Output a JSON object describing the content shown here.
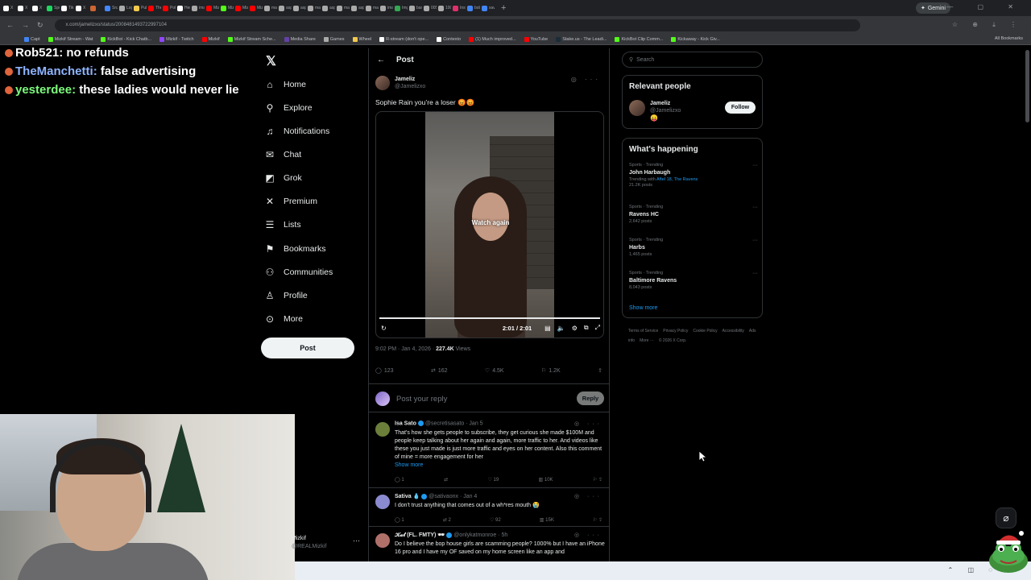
{
  "browser": {
    "tabs": [
      {
        "label": "X",
        "color": "#ffffff"
      },
      {
        "label": "X",
        "color": "#ffffff"
      },
      {
        "label": "X",
        "color": "#ffffff"
      },
      {
        "label": "Spo",
        "color": "#1ed760"
      },
      {
        "label": "Tik",
        "color": "#ffffff"
      },
      {
        "label": "X",
        "color": "#ffffff"
      },
      {
        "label": "",
        "color": "#cc6633"
      },
      {
        "label": "Snz",
        "color": "#4488ff"
      },
      {
        "label": "Log",
        "color": "#aaaaaa"
      },
      {
        "label": "Pull",
        "color": "#f2c94c"
      },
      {
        "label": "The",
        "color": "#ff0000"
      },
      {
        "label": "Pok",
        "color": "#ff0000"
      },
      {
        "label": "Hen",
        "color": "#ffffff"
      },
      {
        "label": "ima",
        "color": "#aaaaaa"
      },
      {
        "label": "Miz",
        "color": "#ff0000"
      },
      {
        "label": "Miz",
        "color": "#53fc18"
      },
      {
        "label": "Miz",
        "color": "#ff0000"
      },
      {
        "label": "Miz",
        "color": "#ff0000"
      },
      {
        "label": "ma",
        "color": "#aaaaaa"
      },
      {
        "label": "asp",
        "color": "#aaaaaa"
      },
      {
        "label": "asp",
        "color": "#aaaaaa"
      },
      {
        "label": "ma",
        "color": "#aaaaaa"
      },
      {
        "label": "asp",
        "color": "#aaaaaa"
      },
      {
        "label": "ma",
        "color": "#aaaaaa"
      },
      {
        "label": "asp",
        "color": "#aaaaaa"
      },
      {
        "label": "ma",
        "color": "#aaaaaa"
      },
      {
        "label": "ima",
        "color": "#aaaaaa"
      },
      {
        "label": "Img",
        "color": "#34a853"
      },
      {
        "label": "ban",
        "color": "#aaaaaa"
      },
      {
        "label": "005",
        "color": "#aaaaaa"
      },
      {
        "label": "100",
        "color": "#aaaaaa"
      },
      {
        "label": "Inst",
        "color": "#e1306c"
      },
      {
        "label": "bob",
        "color": "#4285f4"
      },
      {
        "label": "xav",
        "color": "#4285f4"
      }
    ],
    "new_tab": "+",
    "gemini_label": "Gemini",
    "window_controls": "— ▢ ✕",
    "url": "x.com/jamelizxo/status/2008481493722997104",
    "bookmarks": [
      {
        "label": "Capt",
        "color": "#4285f4"
      },
      {
        "label": "Mizkif Stream - Wat",
        "color": "#53fc18"
      },
      {
        "label": "KickBot - Kick Chatb...",
        "color": "#53fc18"
      },
      {
        "label": "Mizkif - Twitch",
        "color": "#9146ff"
      },
      {
        "label": "Mizkif",
        "color": "#ff0000"
      },
      {
        "label": "Mizkif Stream Sche...",
        "color": "#53fc18"
      },
      {
        "label": "Media Share",
        "color": "#6441a5"
      },
      {
        "label": "Games",
        "color": "#aaaaaa"
      },
      {
        "label": "Wheel",
        "color": "#f2c94c"
      },
      {
        "label": "R-stream (don't ope...",
        "color": "#ffffff"
      },
      {
        "label": "Contexto",
        "color": "#ffffff"
      },
      {
        "label": "(1) Much improved...",
        "color": "#ff0000"
      },
      {
        "label": "YouTube",
        "color": "#ff0000"
      },
      {
        "label": "Stake.us - The Leadi...",
        "color": "#1a2c38"
      },
      {
        "label": "KickBot Clip Comm...",
        "color": "#53fc18"
      },
      {
        "label": "Kickaway - Kick Giv...",
        "color": "#53fc18"
      }
    ],
    "all_bookmarks": "All Bookmarks"
  },
  "stream_chat": [
    {
      "user": "Rob521",
      "message": "no refunds",
      "color": "#ffffff"
    },
    {
      "user": "TheManchetti",
      "message": "false advertising",
      "color": "#8fb4ff"
    },
    {
      "user": "yesterdee",
      "message": "these ladies would never lie",
      "color": "#7cfc7c"
    }
  ],
  "x_sidebar": {
    "logo": "𝕏",
    "items": [
      {
        "label": "Home",
        "icon": "home-icon",
        "glyph": "⌂"
      },
      {
        "label": "Explore",
        "icon": "search-icon",
        "glyph": "⚲"
      },
      {
        "label": "Notifications",
        "icon": "bell-icon",
        "glyph": "♫"
      },
      {
        "label": "Chat",
        "icon": "mail-icon",
        "glyph": "✉"
      },
      {
        "label": "Grok",
        "icon": "grok-icon",
        "glyph": "◩"
      },
      {
        "label": "Premium",
        "icon": "x-icon",
        "glyph": "✕"
      },
      {
        "label": "Lists",
        "icon": "list-icon",
        "glyph": "☰"
      },
      {
        "label": "Bookmarks",
        "icon": "bookmark-icon",
        "glyph": "⚑"
      },
      {
        "label": "Communities",
        "icon": "people-icon",
        "glyph": "⚇"
      },
      {
        "label": "Profile",
        "icon": "person-icon",
        "glyph": "♙"
      },
      {
        "label": "More",
        "icon": "more-circle-icon",
        "glyph": "⊙"
      }
    ],
    "post_button": "Post",
    "account": {
      "name": "Mizkif",
      "handle": "@REALMizkif"
    },
    "dots": "···"
  },
  "post": {
    "back": "←",
    "header": "Post",
    "author": {
      "name": "Jameliz",
      "handle": "@Jamelizxo"
    },
    "tools": "◎ ···",
    "text": "Sophie Rain you’re a loser 😡😡",
    "video": {
      "watch_again": "Watch again",
      "time": "2:01 / 2:01",
      "progress": 1.0
    },
    "time": "9:02 PM · Jan 4, 2026 · ",
    "views_count": "227.4K",
    "views_label": " Views",
    "actions": {
      "replies": "123",
      "reposts": "162",
      "likes": "4.5K",
      "bookmarks": "1.2K"
    },
    "reply_placeholder": "Post your reply",
    "reply_button": "Reply"
  },
  "replies": [
    {
      "name": "Isa Sato",
      "handle": "@secretisasato · Jan 5",
      "text": "That's how she gets people to subscribe, they get curious she made $100M and people keep talking about her again and again, more traffic to her. And videos like these you just made is just more traffic and eyes on her content. Also this comment of mine = more engagement for her",
      "show_more": "Show more",
      "replies": "1",
      "reposts": "",
      "likes": "19",
      "views": "10K",
      "avatar": "#6b7f3a"
    },
    {
      "name": "Sativa 💧",
      "handle": "@sativaonx · Jan 4",
      "text": "I don't trust anything that comes out of a wh*res mouth 😭",
      "show_more": "",
      "replies": "1",
      "reposts": "2",
      "likes": "92",
      "views": "15K",
      "avatar": "#8a8ad0"
    },
    {
      "name": "𝓚𝓪𝓽 (FL. FMTY) 🕶",
      "handle": "@onlykatmonroe · 5h",
      "text": "Do I believe the bop house girls are scamming people? 1000% but I have an iPhone 16 pro and I have my OF saved on my home screen like an app and",
      "show_more": "",
      "replies": "",
      "reposts": "",
      "likes": "",
      "views": "",
      "avatar": "#b0706a"
    }
  ],
  "right": {
    "search_placeholder": "Search",
    "relevant_title": "Relevant people",
    "relevant": {
      "name": "Jameliz",
      "handle": "@Jamelizxo",
      "emoji": "😛"
    },
    "follow": "Follow",
    "happening_title": "What's happening",
    "trends": [
      {
        "category": "Sports · Trending",
        "title": "John Harbaugh",
        "with_prefix": "Trending with ",
        "with_links": "Aftel 18, The Ravens",
        "posts": "21.2K posts"
      },
      {
        "category": "Sports · Trending",
        "title": "Ravens HC",
        "with_prefix": "",
        "with_links": "",
        "posts": "2,642 posts"
      },
      {
        "category": "Sports · Trending",
        "title": "Harbs",
        "with_prefix": "",
        "with_links": "",
        "posts": "1,465 posts"
      },
      {
        "category": "Sports · Trending",
        "title": "Baltimore Ravens",
        "with_prefix": "",
        "with_links": "",
        "posts": "8,043 posts"
      }
    ],
    "show_more": "Show more",
    "footer_links": [
      "Terms of Service",
      "Privacy Policy",
      "Cookie Policy",
      "Accessibility",
      "Ads info",
      "More ···",
      "© 2026 X Corp."
    ]
  },
  "colors": {
    "accent": "#1d9bf0",
    "border": "#2f3336",
    "muted": "#71767b"
  }
}
